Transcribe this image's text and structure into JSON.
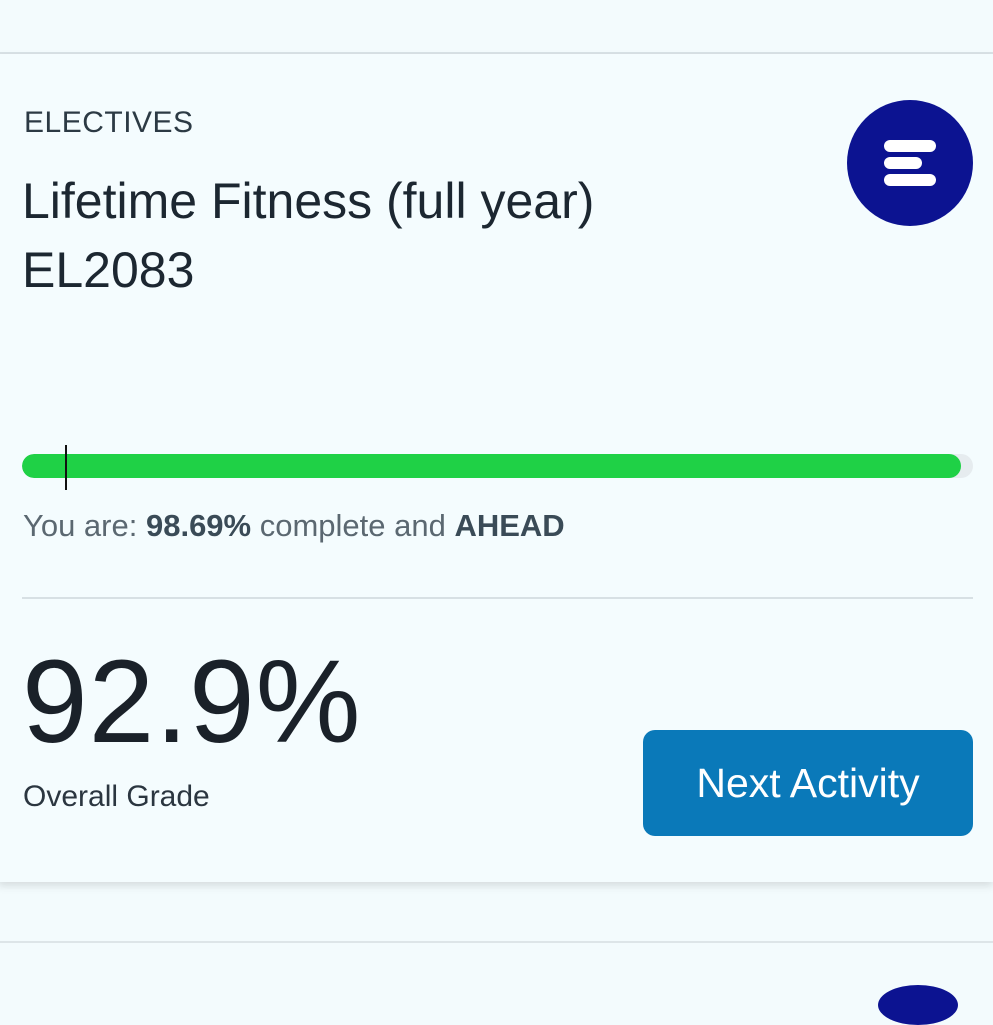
{
  "course_card": {
    "category": "ELECTIVES",
    "title_line1": "Lifetime Fitness (full year)",
    "title_line2": "EL2083",
    "logo_icon": "stacked-bars-icon",
    "logo_color": "#0c1391",
    "progress": {
      "percent_complete": 98.69,
      "fill_color": "#1fd146",
      "marker_fraction": 0.045,
      "prefix": "You are: ",
      "percent_text": "98.69%",
      "middle": " complete and ",
      "status": "AHEAD"
    },
    "grade": {
      "value": "92.9%",
      "label": "Overall Grade"
    },
    "next_button_label": "Next Activity",
    "button_color": "#0a79b9"
  }
}
